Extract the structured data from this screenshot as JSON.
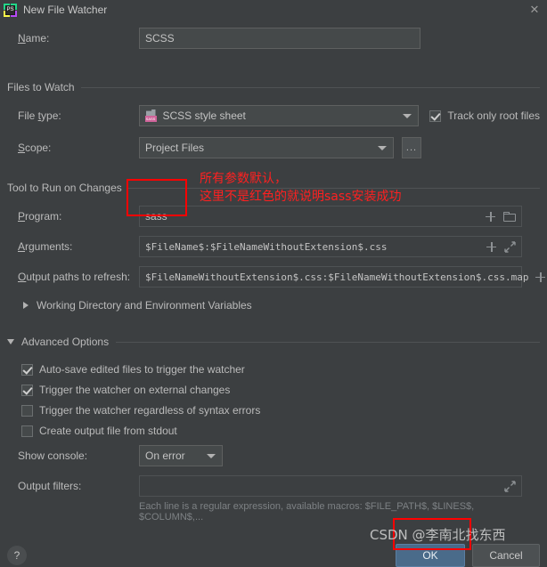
{
  "window": {
    "title": "New File Watcher",
    "icon": "phpstorm-icon",
    "close_label": "✕"
  },
  "name_row": {
    "label": "Name:",
    "value": "SCSS",
    "placeholder": ""
  },
  "files_to_watch": {
    "group_title": "Files to Watch",
    "file_type": {
      "label": "File type:",
      "value": "SCSS style sheet",
      "icon": "scss-file-icon",
      "icon_text": "SASS"
    },
    "track_only_root": {
      "label": "Track only root files",
      "checked": true
    },
    "scope": {
      "label": "Scope:",
      "value": "Project Files",
      "browse_label": "..."
    }
  },
  "tool_to_run": {
    "group_title": "Tool to Run on Changes",
    "program": {
      "label": "Program:",
      "value": "sass"
    },
    "arguments": {
      "label": "Arguments:",
      "value": "$FileName$:$FileNameWithoutExtension$.css"
    },
    "output_paths": {
      "label": "Output paths to refresh:",
      "value": "$FileNameWithoutExtension$.css:$FileNameWithoutExtension$.css.map"
    },
    "working_dir": {
      "label": "Working Directory and Environment Variables",
      "expanded": false
    }
  },
  "advanced_options": {
    "group_title": "Advanced Options",
    "expanded": true,
    "items": [
      {
        "label": "Auto-save edited files to trigger the watcher",
        "checked": true
      },
      {
        "label": "Trigger the watcher on external changes",
        "checked": true
      },
      {
        "label": "Trigger the watcher regardless of syntax errors",
        "checked": false
      },
      {
        "label": "Create output file from stdout",
        "checked": false
      }
    ],
    "show_console": {
      "label": "Show console:",
      "value": "On error"
    },
    "output_filters": {
      "label": "Output filters:",
      "value": "",
      "hint": "Each line is a regular expression, available macros: $FILE_PATH$, $LINES$, $COLUMN$,..."
    }
  },
  "footer": {
    "help_label": "?",
    "ok_label": "OK",
    "cancel_label": "Cancel"
  },
  "annotations": {
    "note_line1": "所有参数默认，",
    "note_line2": "这里不是红色的就说明sass安装成功",
    "highlight_color": "#ff0000"
  },
  "watermark": {
    "text": "CSDN @李南北找东西"
  }
}
